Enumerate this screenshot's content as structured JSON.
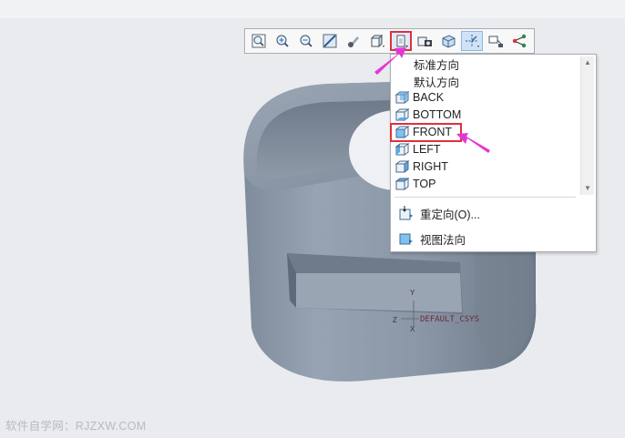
{
  "toolbar": {
    "buttons": [
      {
        "name": "refit-icon"
      },
      {
        "name": "zoom-in-icon"
      },
      {
        "name": "zoom-out-icon"
      },
      {
        "name": "repaint-icon"
      },
      {
        "name": "shading-icon"
      },
      {
        "name": "display-style-icon"
      },
      {
        "name": "saved-orientations-icon",
        "active": true
      },
      {
        "name": "view-manager-icon"
      },
      {
        "name": "perspective-icon"
      },
      {
        "name": "datum-display-icon",
        "toggled": true
      },
      {
        "name": "annotation-display-icon"
      },
      {
        "name": "spin-center-icon"
      }
    ]
  },
  "menu": {
    "items": [
      {
        "label": "标准方向",
        "icon": ""
      },
      {
        "label": "默认方向",
        "icon": ""
      },
      {
        "label": "BACK",
        "icon": "view-cube-icon"
      },
      {
        "label": "BOTTOM",
        "icon": "view-cube-icon"
      },
      {
        "label": "FRONT",
        "icon": "view-cube-icon",
        "highlighted": true
      },
      {
        "label": "LEFT",
        "icon": "view-cube-icon"
      },
      {
        "label": "RIGHT",
        "icon": "view-cube-icon"
      },
      {
        "label": "TOP",
        "icon": "view-cube-icon"
      }
    ],
    "reorient_label": "重定向(O)...",
    "normal_view_label": "视图法向"
  },
  "csys": {
    "label": "DEFAULT_CSYS",
    "axis_y": "Y",
    "axis_z": "Z",
    "axis_x": "X"
  },
  "watermark": "软件自学网：RJZXW.COM",
  "colors": {
    "background": "#e9ebee",
    "model": "#8e9bab",
    "highlight": "#e0303b",
    "arrow": "#e436d6"
  }
}
